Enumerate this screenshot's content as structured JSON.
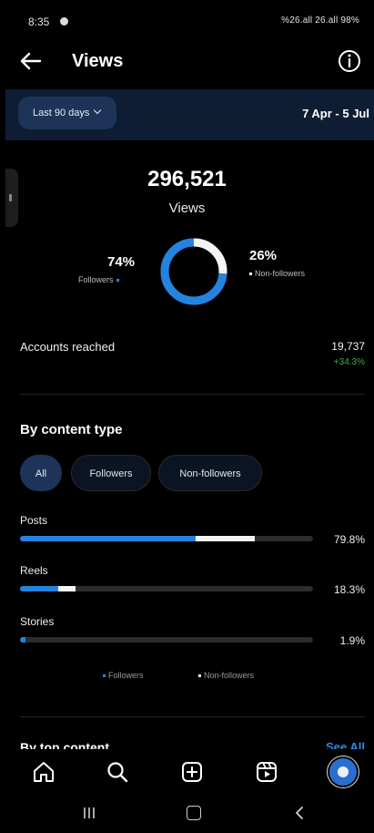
{
  "status_bar": {
    "time": "8:35",
    "indicators": "%26.all 26.all 98%"
  },
  "header": {
    "title": "Views",
    "back_icon": "arrow-left-icon",
    "info_icon": "info-circle-icon"
  },
  "date_filter": {
    "range_label": "Last 90 days",
    "date_range": "7 Apr - 5 Jul"
  },
  "summary": {
    "total_value": "296,521",
    "total_label": "Views",
    "followers": {
      "percent": "74%",
      "label": "Followers",
      "share": 0.74,
      "color": "#2483df"
    },
    "non_followers": {
      "percent": "26%",
      "label": "Non-followers",
      "share": 0.26,
      "color": "#f4f4f4"
    }
  },
  "accounts_reached": {
    "label": "Accounts reached",
    "value": "19,737",
    "change": "+34.3%"
  },
  "content_type": {
    "title": "By content type",
    "filters": [
      {
        "label": "All",
        "active": true
      },
      {
        "label": "Followers",
        "active": false
      },
      {
        "label": "Non-followers",
        "active": false
      }
    ],
    "rows": [
      {
        "label": "Posts",
        "percent": "79.8%",
        "followers_share": 0.6,
        "non_followers_share": 0.2
      },
      {
        "label": "Reels",
        "percent": "18.3%",
        "followers_share": 0.13,
        "non_followers_share": 0.06
      },
      {
        "label": "Stories",
        "percent": "1.9%",
        "followers_share": 0.018,
        "non_followers_share": 0.0
      }
    ],
    "legend": {
      "followers": "Followers",
      "non_followers": "Non-followers"
    }
  },
  "next_section": {
    "title": "By top content",
    "see_all": "See All"
  },
  "bottom_nav": {
    "items": [
      "home-icon",
      "search-icon",
      "create-post-icon",
      "reels-icon",
      "profile-avatar"
    ]
  },
  "system_nav": [
    "recent-apps-icon",
    "home-button-icon",
    "back-nav-icon"
  ]
}
